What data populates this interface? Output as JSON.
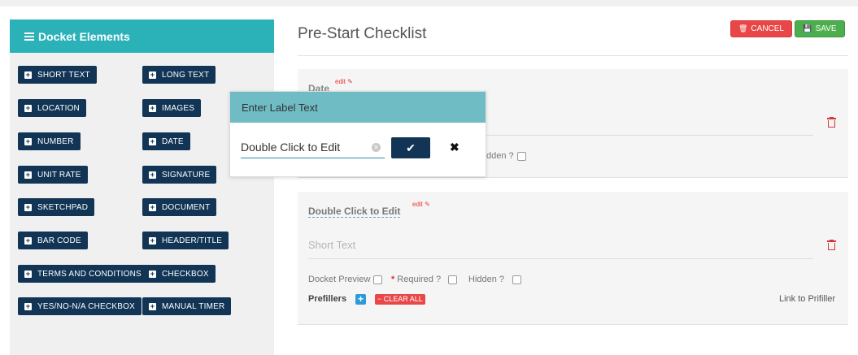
{
  "sidebar": {
    "title": "Docket Elements",
    "items": [
      {
        "label": "SHORT TEXT"
      },
      {
        "label": "LONG TEXT"
      },
      {
        "label": "LOCATION"
      },
      {
        "label": "IMAGES"
      },
      {
        "label": "NUMBER"
      },
      {
        "label": "DATE"
      },
      {
        "label": "UNIT RATE"
      },
      {
        "label": "SIGNATURE"
      },
      {
        "label": "SKETCHPAD"
      },
      {
        "label": "DOCUMENT"
      },
      {
        "label": "BAR CODE"
      },
      {
        "label": "HEADER/TITLE"
      },
      {
        "label": "TERMS AND CONDITIONS"
      },
      {
        "label": "CHECKBOX"
      },
      {
        "label": "YES/NO-N/A CHECKBOX"
      },
      {
        "label": "MANUAL TIMER"
      }
    ]
  },
  "header": {
    "title": "Pre-Start Checklist",
    "cancel_label": "CANCEL",
    "save_label": "SAVE"
  },
  "card1": {
    "label": "Date",
    "edit": "edit",
    "hidden_fragment": "dden ?"
  },
  "card2": {
    "label": "Double Click to Edit",
    "edit": "edit",
    "placeholder": "Short Text",
    "docket_preview": "Docket Preview",
    "required": "Required ?",
    "required_mark": "*",
    "hidden": "Hidden ?",
    "prefillers": "Prefillers",
    "clear_all": "CLEAR ALL",
    "link_prefiller": "Link to Prifiller"
  },
  "popup": {
    "title": "Enter Label Text",
    "input_value": "Double Click to Edit"
  },
  "colors": {
    "teal": "#2bb1b8",
    "navy": "#123556",
    "danger": "#e94747",
    "success": "#4cae4c"
  }
}
